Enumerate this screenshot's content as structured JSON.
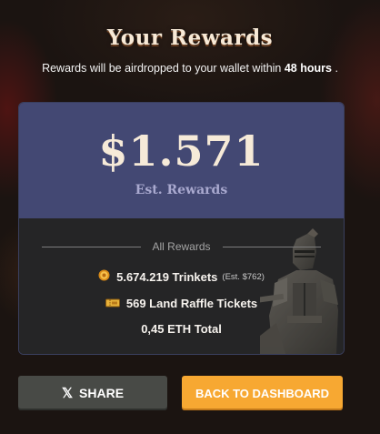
{
  "header": {
    "title": "Your Rewards",
    "subtitle_prefix": "Rewards will be airdropped to your wallet within ",
    "subtitle_bold": "48 hours",
    "subtitle_suffix": " ."
  },
  "summary": {
    "amount": "$1.571",
    "label": "Est. Rewards"
  },
  "rewards": {
    "heading": "All Rewards",
    "items": [
      {
        "icon": "coin-icon",
        "text": "5.674.219 Trinkets",
        "note": "(Est. $762)"
      },
      {
        "icon": "ticket-icon",
        "text": "569 Land Raffle Tickets",
        "note": ""
      },
      {
        "icon": "",
        "text": "0,45 ETH Total",
        "note": ""
      }
    ]
  },
  "actions": {
    "share_icon": "x-logo-icon",
    "share_label": "SHARE",
    "dashboard_label": "BACK TO DASHBOARD"
  },
  "colors": {
    "accent": "#f7a832",
    "card_top": "#434873",
    "card_bottom": "#252526",
    "share_button": "#484a46"
  }
}
